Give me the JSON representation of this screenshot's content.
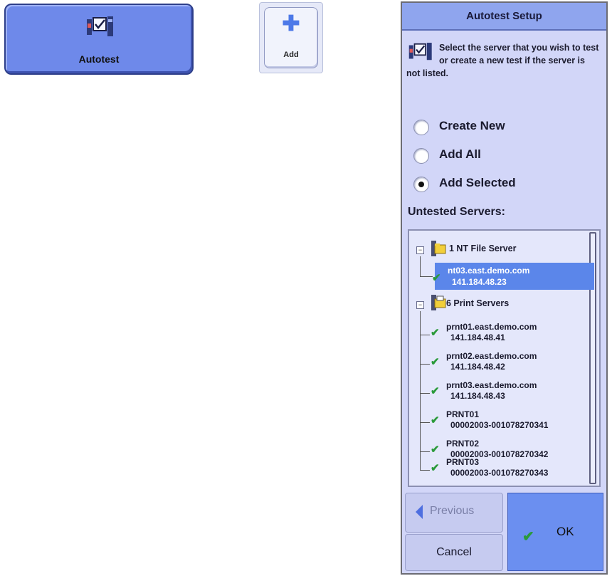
{
  "autotest_button": {
    "label": "Autotest",
    "icon": "autotest-icon"
  },
  "add_button": {
    "label": "Add",
    "icon": "plus-icon"
  },
  "setup": {
    "title": "Autotest Setup",
    "instruction": "Select the server that you wish to test or create a new test if the server is not listed.",
    "options": [
      {
        "label": "Create New",
        "selected": false
      },
      {
        "label": "Add All",
        "selected": false
      },
      {
        "label": "Add Selected",
        "selected": true
      }
    ],
    "list_label": "Untested Servers:",
    "groups": [
      {
        "label": "1 NT File Server",
        "items": [
          {
            "name": "nt03.east.demo.com",
            "detail": "141.184.48.23",
            "selected": true
          }
        ]
      },
      {
        "label": "6 Print Servers",
        "items": [
          {
            "name": "prnt01.east.demo.com",
            "detail": "141.184.48.41"
          },
          {
            "name": "prnt02.east.demo.com",
            "detail": "141.184.48.42"
          },
          {
            "name": "prnt03.east.demo.com",
            "detail": "141.184.48.43"
          },
          {
            "name": "PRNT01",
            "detail": "00002003-001078270341"
          },
          {
            "name": "PRNT02",
            "detail": "00002003-001078270342"
          },
          {
            "name": "PRNT03",
            "detail": "00002003-001078270343"
          }
        ]
      }
    ],
    "buttons": {
      "previous": "Previous",
      "cancel": "Cancel",
      "ok": "OK"
    }
  },
  "colors": {
    "panel_bg": "#d2d6f8",
    "title_bg": "#8fa5ee",
    "selection": "#5b86ea",
    "ok_bg": "#6b8ff0",
    "check": "#2a9a3a"
  }
}
